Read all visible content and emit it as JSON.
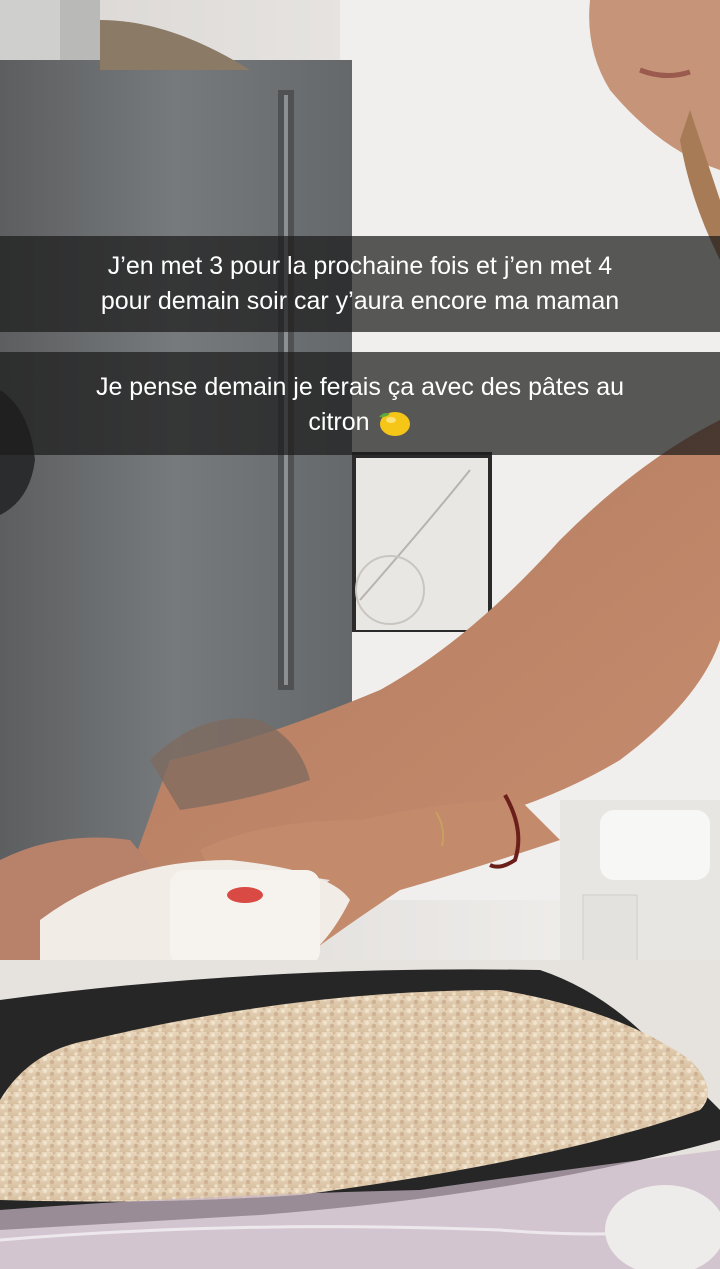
{
  "captions": [
    {
      "lines": [
        "J’en met 3 pour la prochaine fois et j’en met 4",
        "pour demain soir car y’aura encore ma maman"
      ]
    },
    {
      "lines": [
        "Je pense demain je ferais ça avec des pâtes au",
        "citron"
      ],
      "emoji": "lemon-icon"
    }
  ],
  "colors": {
    "caption_background": "#1c1c1c",
    "caption_text": "#ffffff",
    "lemon": "#f5c518"
  }
}
